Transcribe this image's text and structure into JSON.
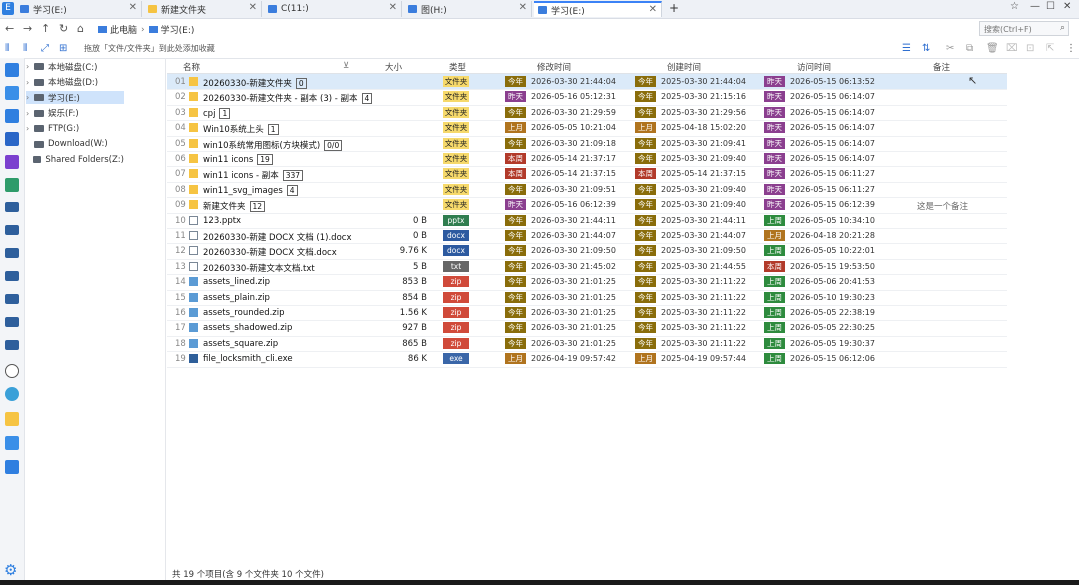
{
  "tabs": [
    {
      "label": "学习(E:)",
      "icon": "drive-icon",
      "active": false
    },
    {
      "label": "新建文件夹",
      "icon": "folder-icon",
      "active": false
    },
    {
      "label": "C(11:)",
      "icon": "drive-icon",
      "active": false
    },
    {
      "label": "图(H:)",
      "icon": "drive-icon",
      "active": false
    },
    {
      "label": "学习(E:)",
      "icon": "drive-icon",
      "active": true
    }
  ],
  "add_tab": "+",
  "address": {
    "breadcrumbs": [
      "此电脑",
      "学习(E:)"
    ],
    "search_placeholder": "搜索(Ctrl+F)"
  },
  "toolbar": {
    "hint": "拖放「文件/文件夹」到此处添加收藏"
  },
  "tree": [
    {
      "label": "本地磁盘(C:)",
      "selected": false
    },
    {
      "label": "本地磁盘(D:)",
      "selected": false
    },
    {
      "label": "学习(E:)",
      "selected": true
    },
    {
      "label": "娱乐(F:)",
      "selected": false
    },
    {
      "label": "FTP(G:)",
      "selected": false
    },
    {
      "label": "Download(W:)",
      "selected": false
    },
    {
      "label": "Shared Folders(Z:)",
      "selected": false
    }
  ],
  "columns": {
    "name": "名称",
    "size": "大小",
    "type": "类型",
    "modified": "修改时间",
    "created": "创建时间",
    "accessed": "访问时间",
    "note": "备注"
  },
  "files": [
    {
      "num": "01",
      "name": "20260330-新建文件夹",
      "count": "0",
      "size": "",
      "type": "文件夹",
      "kind": "folder",
      "mtag": "今年",
      "mtime": "2026-03-30 21:44:04",
      "ctag": "今年",
      "ctime": "2025-03-30 21:44:04",
      "atag": "昨天",
      "atime": "2026-05-15 06:13:52",
      "note": ""
    },
    {
      "num": "02",
      "name": "20260330-新建文件夹 - 副本 (3) - 副本",
      "count": "4",
      "size": "",
      "type": "文件夹",
      "kind": "folder",
      "mtag": "昨天",
      "mtime": "2026-05-16 05:12:31",
      "ctag": "今年",
      "ctime": "2025-03-30 21:15:16",
      "atag": "昨天",
      "atime": "2026-05-15 06:14:07",
      "note": ""
    },
    {
      "num": "03",
      "name": "cpj",
      "count": "1",
      "size": "",
      "type": "文件夹",
      "kind": "folder",
      "mtag": "今年",
      "mtime": "2026-03-30 21:29:59",
      "ctag": "今年",
      "ctime": "2025-03-30 21:29:56",
      "atag": "昨天",
      "atime": "2026-05-15 06:14:07",
      "note": ""
    },
    {
      "num": "04",
      "name": "Win10系统上头",
      "count": "1",
      "size": "",
      "type": "文件夹",
      "kind": "folder",
      "mtag": "上月",
      "mtime": "2026-05-05 10:21:04",
      "ctag": "上月",
      "ctime": "2025-04-18 15:02:20",
      "atag": "昨天",
      "atime": "2026-05-15 06:14:07",
      "note": ""
    },
    {
      "num": "05",
      "name": "win10系统常用图标(方块模式)",
      "count": "0/0",
      "size": "",
      "type": "文件夹",
      "kind": "folder",
      "mtag": "今年",
      "mtime": "2026-03-30 21:09:18",
      "ctag": "今年",
      "ctime": "2025-03-30 21:09:41",
      "atag": "昨天",
      "atime": "2026-05-15 06:14:07",
      "note": ""
    },
    {
      "num": "06",
      "name": "win11 icons",
      "count": "19",
      "size": "",
      "type": "文件夹",
      "kind": "folder",
      "mtag": "本周",
      "mtime": "2026-05-14 21:37:17",
      "ctag": "今年",
      "ctime": "2025-03-30 21:09:40",
      "atag": "昨天",
      "atime": "2026-05-15 06:14:07",
      "note": ""
    },
    {
      "num": "07",
      "name": "win11 icons - 副本",
      "count": "337",
      "size": "",
      "type": "文件夹",
      "kind": "folder",
      "mtag": "本周",
      "mtime": "2026-05-14 21:37:15",
      "ctag": "本周",
      "ctime": "2025-05-14 21:37:15",
      "atag": "昨天",
      "atime": "2026-05-15 06:11:27",
      "note": ""
    },
    {
      "num": "08",
      "name": "win11_svg_images",
      "count": "4",
      "size": "",
      "type": "文件夹",
      "kind": "folder",
      "mtag": "今年",
      "mtime": "2026-03-30 21:09:51",
      "ctag": "今年",
      "ctime": "2025-03-30 21:09:40",
      "atag": "昨天",
      "atime": "2026-05-15 06:11:27",
      "note": ""
    },
    {
      "num": "09",
      "name": "新建文件夹",
      "count": "12",
      "size": "",
      "type": "文件夹",
      "kind": "folder",
      "mtag": "昨天",
      "mtime": "2026-05-16 06:12:39",
      "ctag": "今年",
      "ctime": "2025-03-30 21:09:40",
      "atag": "昨天",
      "atime": "2026-05-15 06:12:39",
      "note": "这是一个备注"
    },
    {
      "num": "10",
      "name": "123.pptx",
      "count": "",
      "size": "0 B",
      "type": "pptx",
      "kind": "file",
      "mtag": "今年",
      "mtime": "2026-03-30 21:44:11",
      "ctag": "今年",
      "ctime": "2025-03-30 21:44:11",
      "atag": "上周",
      "atime": "2026-05-05 10:34:10",
      "note": ""
    },
    {
      "num": "11",
      "name": "20260330-新建 DOCX 文档 (1).docx",
      "count": "",
      "size": "0 B",
      "type": "docx",
      "kind": "file",
      "mtag": "今年",
      "mtime": "2026-03-30 21:44:07",
      "ctag": "今年",
      "ctime": "2025-03-30 21:44:07",
      "atag": "上月",
      "atime": "2026-04-18 20:21:28",
      "note": ""
    },
    {
      "num": "12",
      "name": "20260330-新建 DOCX 文档.docx",
      "count": "",
      "size": "9.76 K",
      "type": "docx",
      "kind": "file",
      "mtag": "今年",
      "mtime": "2026-03-30 21:09:50",
      "ctag": "今年",
      "ctime": "2025-03-30 21:09:50",
      "atag": "上周",
      "atime": "2026-05-05 10:22:01",
      "note": ""
    },
    {
      "num": "13",
      "name": "20260330-新建文本文档.txt",
      "count": "",
      "size": "5 B",
      "type": "txt",
      "kind": "file",
      "mtag": "今年",
      "mtime": "2026-03-30 21:45:02",
      "ctag": "今年",
      "ctime": "2025-03-30 21:44:55",
      "atag": "本周",
      "atime": "2026-05-15 19:53:50",
      "note": ""
    },
    {
      "num": "14",
      "name": "assets_lined.zip",
      "count": "",
      "size": "853 B",
      "type": "zip",
      "kind": "zip",
      "mtag": "今年",
      "mtime": "2026-03-30 21:01:25",
      "ctag": "今年",
      "ctime": "2025-03-30 21:11:22",
      "atag": "上周",
      "atime": "2026-05-06 20:41:53",
      "note": ""
    },
    {
      "num": "15",
      "name": "assets_plain.zip",
      "count": "",
      "size": "854 B",
      "type": "zip",
      "kind": "zip",
      "mtag": "今年",
      "mtime": "2026-03-30 21:01:25",
      "ctag": "今年",
      "ctime": "2025-03-30 21:11:22",
      "atag": "上周",
      "atime": "2026-05-10 19:30:23",
      "note": ""
    },
    {
      "num": "16",
      "name": "assets_rounded.zip",
      "count": "",
      "size": "1.56 K",
      "type": "zip",
      "kind": "zip",
      "mtag": "今年",
      "mtime": "2026-03-30 21:01:25",
      "ctag": "今年",
      "ctime": "2025-03-30 21:11:22",
      "atag": "上周",
      "atime": "2026-05-05 22:38:19",
      "note": ""
    },
    {
      "num": "17",
      "name": "assets_shadowed.zip",
      "count": "",
      "size": "927 B",
      "type": "zip",
      "kind": "zip",
      "mtag": "今年",
      "mtime": "2026-03-30 21:01:25",
      "ctag": "今年",
      "ctime": "2025-03-30 21:11:22",
      "atag": "上周",
      "atime": "2026-05-05 22:30:25",
      "note": ""
    },
    {
      "num": "18",
      "name": "assets_square.zip",
      "count": "",
      "size": "865 B",
      "type": "zip",
      "kind": "zip",
      "mtag": "今年",
      "mtime": "2026-03-30 21:01:25",
      "ctag": "今年",
      "ctime": "2025-03-30 21:11:22",
      "atag": "上周",
      "atime": "2026-05-05 19:30:37",
      "note": ""
    },
    {
      "num": "19",
      "name": "file_locksmith_cli.exe",
      "count": "",
      "size": "86 K",
      "type": "exe",
      "kind": "exe",
      "mtag": "上月",
      "mtime": "2026-04-19 09:57:42",
      "ctag": "上月",
      "ctime": "2025-04-19 09:57:44",
      "atag": "上周",
      "atime": "2026-05-15 06:12:06",
      "note": ""
    }
  ],
  "status": "共 19 个项目(含 9 个文件夹 10 个文件)",
  "colors": {
    "accent": "#2f7fe0",
    "tag_today_year": "#8a6d0b",
    "tag_week": "#b23a2a",
    "tag_lastweek": "#2e8b3e",
    "tag_yesterday": "#8b3f8f",
    "tag_lastmonth": "#b0741f",
    "type_folder": "#f6d96b",
    "type_pptx": "#2f7d4f",
    "type_docx": "#2d5aa0",
    "type_txt": "#666666",
    "type_zip": "#d04a3a",
    "type_exe": "#3a66a8"
  }
}
